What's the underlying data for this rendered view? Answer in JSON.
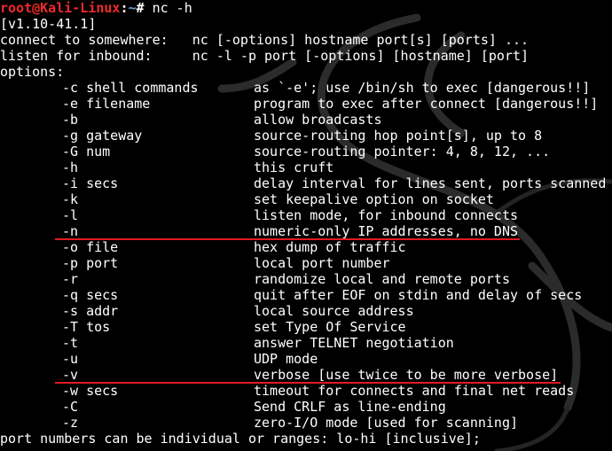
{
  "prompt": {
    "user_host": "root@Kali-Linux",
    "separator": ":",
    "path": "~",
    "symbol": "#",
    "command": " nc -h"
  },
  "version": "[v1.10-41.1]",
  "usage": [
    "connect to somewhere:   nc [-options] hostname port[s] [ports] ...",
    "listen for inbound:     nc -l -p port [-options] [hostname] [port]"
  ],
  "options_header": "options:",
  "options": [
    {
      "flag": "-c shell commands",
      "desc": "as `-e'; use /bin/sh to exec [dangerous!!]"
    },
    {
      "flag": "-e filename",
      "desc": "program to exec after connect [dangerous!!]"
    },
    {
      "flag": "-b",
      "desc": "allow broadcasts"
    },
    {
      "flag": "-g gateway",
      "desc": "source-routing hop point[s], up to 8"
    },
    {
      "flag": "-G num",
      "desc": "source-routing pointer: 4, 8, 12, ..."
    },
    {
      "flag": "-h",
      "desc": "this cruft"
    },
    {
      "flag": "-i secs",
      "desc": "delay interval for lines sent, ports scanned"
    },
    {
      "flag": "-k",
      "desc": "set keepalive option on socket"
    },
    {
      "flag": "-l",
      "desc": "listen mode, for inbound connects"
    },
    {
      "flag": "-n",
      "desc": "numeric-only IP addresses, no DNS"
    },
    {
      "flag": "-o file",
      "desc": "hex dump of traffic"
    },
    {
      "flag": "-p port",
      "desc": "local port number"
    },
    {
      "flag": "-r",
      "desc": "randomize local and remote ports"
    },
    {
      "flag": "-q secs",
      "desc": "quit after EOF on stdin and delay of secs"
    },
    {
      "flag": "-s addr",
      "desc": "local source address"
    },
    {
      "flag": "-T tos",
      "desc": "set Type Of Service"
    },
    {
      "flag": "-t",
      "desc": "answer TELNET negotiation"
    },
    {
      "flag": "-u",
      "desc": "UDP mode"
    },
    {
      "flag": "-v",
      "desc": "verbose [use twice to be more verbose]"
    },
    {
      "flag": "-w secs",
      "desc": "timeout for connects and final net reads"
    },
    {
      "flag": "-C",
      "desc": "Send CRLF as line-ending"
    },
    {
      "flag": "-z",
      "desc": "zero-I/O mode [used for scanning]"
    }
  ],
  "footer": "port numbers can be individual or ranges: lo-hi [inclusive];",
  "colors": {
    "background": "#000000",
    "text": "#ffffff",
    "prompt_user": "#ef2929",
    "prompt_path": "#729fcf",
    "annotation": "#e01b24"
  },
  "icons": {
    "background_logo": "kali-dragon-icon"
  }
}
